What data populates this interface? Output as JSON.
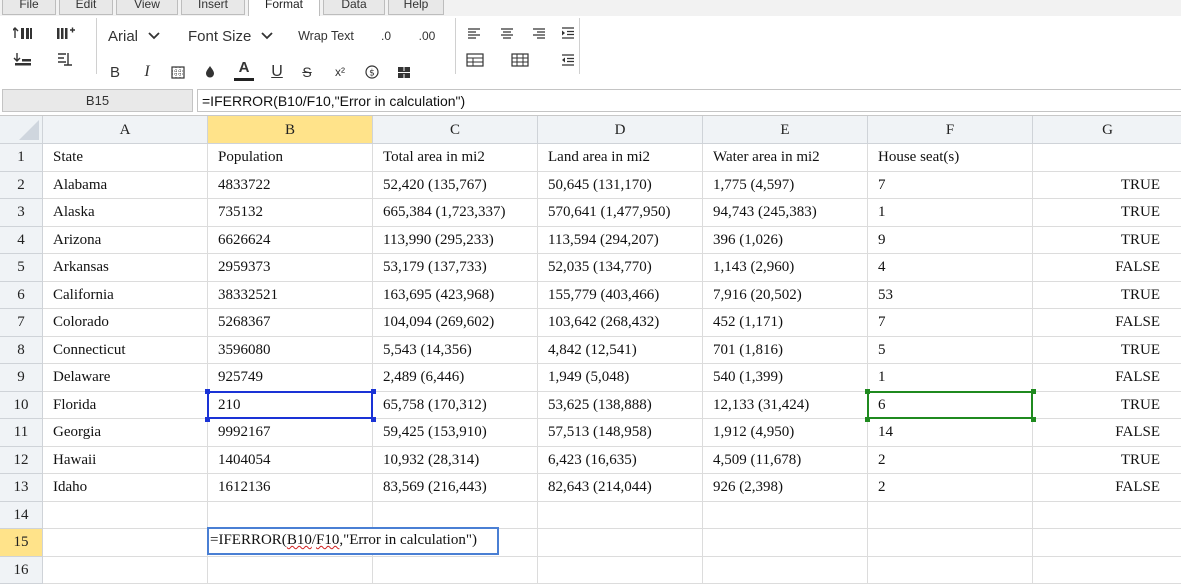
{
  "menu": {
    "tabs": [
      "File",
      "Edit",
      "View",
      "Insert",
      "Format",
      "Data",
      "Help"
    ],
    "active": "Format"
  },
  "toolbar": {
    "font_name": "Arial",
    "font_size": "Font Size",
    "wrap_text": "Wrap Text",
    "decrease_decimal": ".0",
    "increase_decimal": ".00",
    "bold": "B",
    "italic": "I",
    "underline": "U",
    "strikethrough": "S",
    "superscript": "x²"
  },
  "formula_bar": {
    "name_box": "B15",
    "formula": "=IFERROR(B10/F10,\"Error in calculation\")"
  },
  "sheet": {
    "columns": [
      "A",
      "B",
      "C",
      "D",
      "E",
      "F",
      "G"
    ],
    "selected_column": "B",
    "rows": [
      [
        "State",
        "Population",
        "Total area in mi2",
        "Land area in mi2",
        "Water area in mi2",
        "House seat(s)",
        ""
      ],
      [
        "Alabama",
        "4833722",
        "52,420 (135,767)",
        "50,645 (131,170)",
        "1,775 (4,597)",
        "7",
        "TRUE"
      ],
      [
        "Alaska",
        "735132",
        "665,384 (1,723,337)",
        "570,641 (1,477,950)",
        "94,743 (245,383)",
        "1",
        "TRUE"
      ],
      [
        "Arizona",
        "6626624",
        "113,990 (295,233)",
        "113,594 (294,207)",
        "396 (1,026)",
        "9",
        "TRUE"
      ],
      [
        "Arkansas",
        "2959373",
        "53,179 (137,733)",
        "52,035 (134,770)",
        "1,143 (2,960)",
        "4",
        "FALSE"
      ],
      [
        "California",
        "38332521",
        "163,695 (423,968)",
        "155,779 (403,466)",
        "7,916 (20,502)",
        "53",
        "TRUE"
      ],
      [
        "Colorado",
        "5268367",
        "104,094 (269,602)",
        "103,642 (268,432)",
        "452 (1,171)",
        "7",
        "FALSE"
      ],
      [
        "Connecticut",
        "3596080",
        "5,543 (14,356)",
        "4,842 (12,541)",
        "701 (1,816)",
        "5",
        "TRUE"
      ],
      [
        "Delaware",
        "925749",
        "2,489 (6,446)",
        "1,949 (5,048)",
        "540 (1,399)",
        "1",
        "FALSE"
      ],
      [
        "Florida",
        "210",
        "65,758 (170,312)",
        "53,625 (138,888)",
        "12,133 (31,424)",
        "6",
        "TRUE"
      ],
      [
        "Georgia",
        "9992167",
        "59,425 (153,910)",
        "57,513 (148,958)",
        "1,912 (4,950)",
        "14",
        "FALSE"
      ],
      [
        "Hawaii",
        "1404054",
        "10,932 (28,314)",
        "6,423 (16,635)",
        "4,509 (11,678)",
        "2",
        "TRUE"
      ],
      [
        "Idaho",
        "1612136",
        "83,569 (216,443)",
        "82,643 (214,044)",
        "926 (2,398)",
        "2",
        "FALSE"
      ],
      [
        "",
        "",
        "",
        "",
        "",
        "",
        ""
      ],
      [
        "",
        "",
        "",
        "",
        "",
        "",
        ""
      ],
      [
        "",
        "",
        "",
        "",
        "",
        "",
        ""
      ]
    ],
    "selected_row": 15,
    "editor": {
      "prefix": "=IFERROR(",
      "ref1": "B10",
      "slash": "/",
      "ref2": "F10",
      "suffix": ",\"Error in calculation\")"
    }
  },
  "colors": {
    "selection_header": "#ffe38a",
    "ref_blue": "#1a33d6",
    "ref_green": "#1f8a1f"
  }
}
